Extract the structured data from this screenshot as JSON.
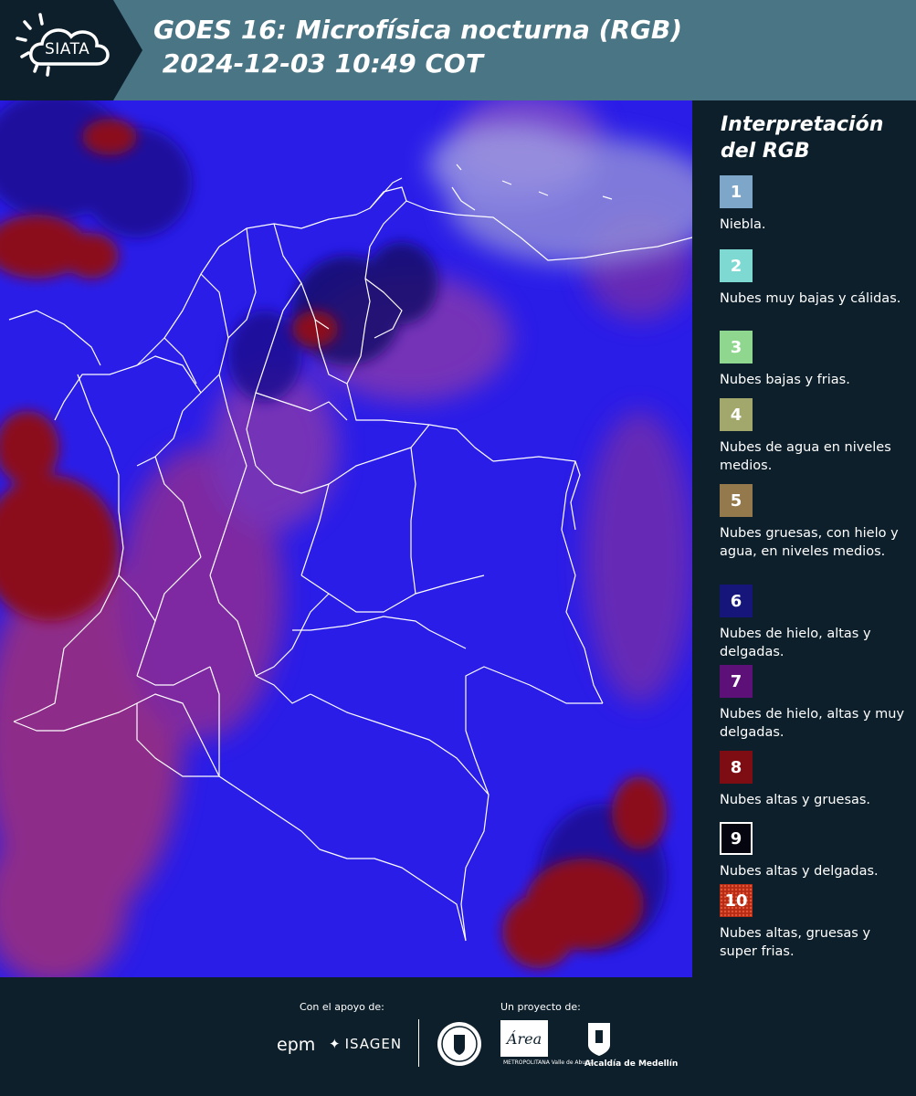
{
  "header": {
    "logo_text": "SIATA",
    "title_line1": "GOES 16: Microfísica nocturna (RGB)",
    "title_line2": " 2024-12-03 10:49 COT",
    "background_color": "#4a7585",
    "logo_background_color": "#0d1f2b"
  },
  "map": {
    "background_color": "#2a1de8",
    "boundary_color": "#ffffff",
    "cloud_colors": [
      "#8b0f1f",
      "#b0306a",
      "#1a1190",
      "#8e8ad9"
    ]
  },
  "legend": {
    "title": "Interpretación del RGB",
    "items": [
      {
        "number": "1",
        "label": "Niebla.",
        "color": "#7ea6c9"
      },
      {
        "number": "2",
        "label": "Nubes muy bajas y cálidas.",
        "color": "#7ed9d3"
      },
      {
        "number": "3",
        "label": "Nubes bajas y frias.",
        "color": "#8fd68f"
      },
      {
        "number": "4",
        "label": "Nubes de agua en niveles medios.",
        "color": "#a2a86b"
      },
      {
        "number": "5",
        "label": "Nubes gruesas, con hielo y agua, en niveles medios.",
        "color": "#93794c"
      },
      {
        "number": "6",
        "label": "Nubes de hielo, altas y delgadas.",
        "color": "#16157a"
      },
      {
        "number": "7",
        "label": "Nubes de hielo, altas y muy delgadas.",
        "color": "#5d1078"
      },
      {
        "number": "8",
        "label": "Nubes altas y gruesas.",
        "color": "#7d0d12"
      },
      {
        "number": "9",
        "label": "Nubes altas y delgadas.",
        "color": "#050510"
      },
      {
        "number": "10",
        "label": "Nubes altas, gruesas y super frias.",
        "color": "#b82a14"
      }
    ]
  },
  "footer": {
    "support_label": "Con el apoyo de:",
    "project_label": "Un proyecto de:",
    "sponsors": [
      "epm",
      "ISAGEN"
    ],
    "area_caption": "METROPOLITANA Valle de Aburrá",
    "alcaldia_caption": "Alcaldía de Medellín",
    "area_logo_text": "Área"
  }
}
